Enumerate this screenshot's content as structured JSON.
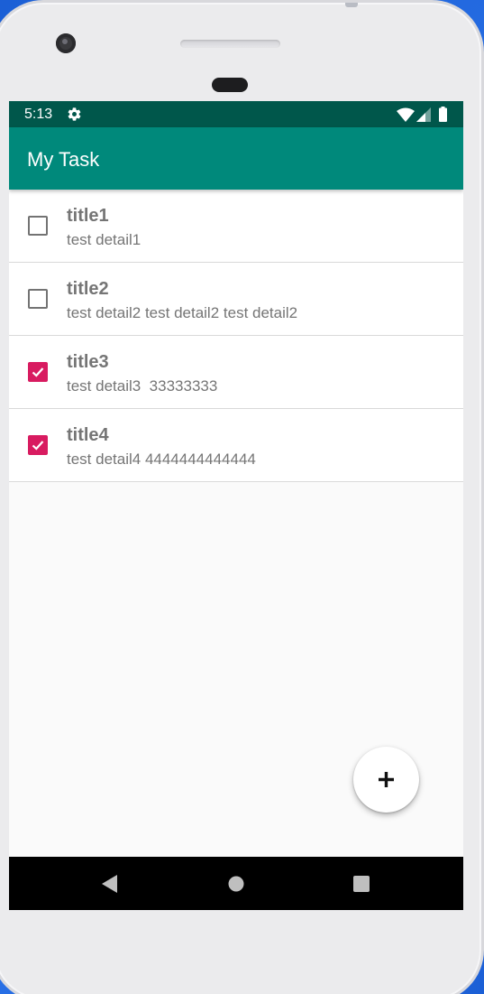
{
  "status_bar": {
    "time": "5:13",
    "icons": [
      "settings-gear-icon",
      "wifi-icon",
      "cell-signal-icon",
      "battery-icon"
    ],
    "background_color": "#00574b"
  },
  "app_bar": {
    "title": "My Task",
    "background_color": "#00897b"
  },
  "tasks": [
    {
      "title": "title1",
      "detail": "test detail1",
      "checked": false
    },
    {
      "title": "title2",
      "detail": "test detail2 test detail2 test detail2",
      "checked": false
    },
    {
      "title": "title3",
      "detail": "test detail3  33333333",
      "checked": true
    },
    {
      "title": "title4",
      "detail": "test detail4 4444444444444",
      "checked": true
    }
  ],
  "fab": {
    "icon": "plus-icon"
  },
  "nav_bar": {
    "icons": [
      "back-icon",
      "home-icon",
      "recents-icon"
    ]
  },
  "colors": {
    "accent": "#d81b60",
    "text_secondary": "#757575"
  }
}
